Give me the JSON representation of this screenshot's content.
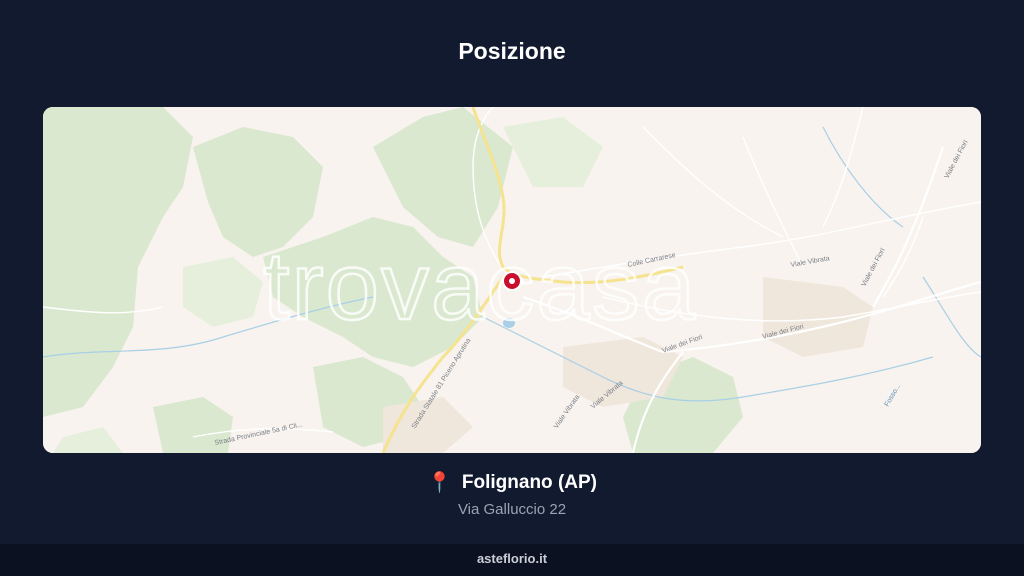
{
  "page": {
    "title": "Posizione"
  },
  "map": {
    "watermark": "trovacasa",
    "labels": {
      "ss_piceno": "Strada Statale 81 Piceno Aprutina",
      "sp_cli": "Strada Provinciale 5a di Cli...",
      "viale_fiori_1": "Viale dei Fiori",
      "viale_fiori_2": "Viale dei Fiori",
      "viale_fiori_3": "Viale dei Fiori",
      "viale_fiori_4": "Viale dei Fiori",
      "viale_vibrata_1": "Viale Vibrata",
      "viale_vibrata_2": "Viale Vibrata",
      "viale_vibrata_3": "Viale Vibrata",
      "colle_carrarese": "Colle Carrarese",
      "fosso": "Fosso..."
    },
    "colors": {
      "land": "#f8f3ee",
      "forest": "#d9e8cf",
      "road_major": "#f6e38f",
      "water": "#a8cfe6",
      "marker": "#c8102e"
    }
  },
  "location": {
    "icon": "map-pin-icon",
    "city": "Folignano (AP)",
    "address": "Via Galluccio 22"
  },
  "footer": {
    "brand": "asteflorio.it"
  }
}
